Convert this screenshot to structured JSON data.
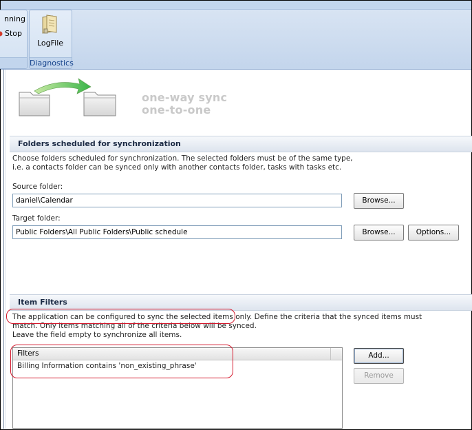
{
  "ribbon": {
    "running_label": "nning",
    "stop_label": "Stop",
    "logfile_label": "LogFile",
    "diagnostics_group_label": "Diagnostics"
  },
  "header": {
    "line1": "one-way sync",
    "line2": "one-to-one"
  },
  "folders_section": {
    "title": "Folders scheduled for synchronization",
    "description_line1": "Choose folders scheduled for synchronization. The selected folders must be of the same type,",
    "description_line2": "i.e. a contacts folder can be synced only with another contacts folder, tasks with tasks etc.",
    "source_label": "Source folder:",
    "source_value": "daniel\\Calendar",
    "target_label": "Target folder:",
    "target_value": "Public Folders\\All Public Folders\\Public schedule",
    "browse_label": "Browse...",
    "options_label": "Options..."
  },
  "filters_section": {
    "title": "Item Filters",
    "description_line1": "The application can be configured to sync the selected items only. Define the criteria that the synced items must",
    "description_line2": "match. Only items matching all of the criteria below will be synced.",
    "description_line3": "Leave the field empty to synchronize all items.",
    "list_header": "Filters",
    "items": [
      "Billing Information contains 'non_existing_phrase'"
    ],
    "add_label": "Add...",
    "remove_label": "Remove"
  },
  "colors": {
    "annotation": "#d4192d",
    "ribbon_group_label": "#15428b"
  }
}
